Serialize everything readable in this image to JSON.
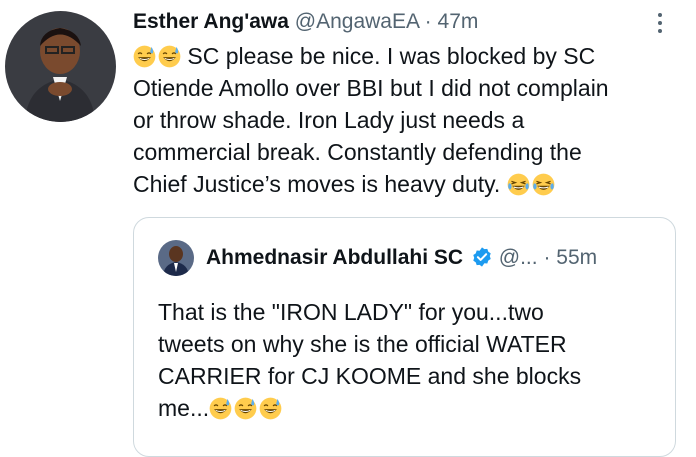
{
  "tweet": {
    "author_name": "Esther Ang'awa",
    "handle": "@AngawaEA",
    "separator": "·",
    "time": "47m",
    "text_line1": " SC please be nice. I was blocked by SC",
    "text_line2": "Otiende Amollo over BBI but I did not complain",
    "text_line3": "or throw shade. Iron Lady just needs a",
    "text_line4": "commercial break. Constantly defending the",
    "text_line5": "Chief Justice’s moves is heavy duty. ",
    "emoji_lead": "sweat-smile-emoji",
    "emoji_tail": "tears-of-joy-emoji"
  },
  "quote": {
    "author_name": "Ahmednasir Abdullahi SC",
    "verified_icon": "verified-badge-icon",
    "handle": "@...",
    "separator": "·",
    "time": "55m",
    "text_line1": "That is the \"IRON LADY\" for you...two",
    "text_line2": "tweets on why she is the official WATER",
    "text_line3": "CARRIER for CJ KOOME and she blocks",
    "text_line4": "me...",
    "emoji_tail": "sweat-smile-emoji"
  },
  "colors": {
    "text": "#0f1419",
    "muted": "#536471",
    "border": "#cfd9de",
    "verified": "#1d9bf0",
    "emoji_face": "#ffcc4d"
  }
}
